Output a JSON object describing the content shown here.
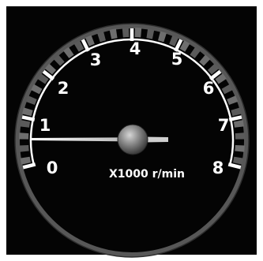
{
  "gauge": {
    "type": "tachometer",
    "unit_label": "X1000 r/min",
    "scale_labels": [
      "0",
      "1",
      "2",
      "3",
      "4",
      "5",
      "6",
      "7",
      "8"
    ],
    "min": 0,
    "max": 8,
    "needle_value": 0.9,
    "colors": {
      "background": "#040404",
      "scale_ring": "#ffffff",
      "segments": "#6e6e6e",
      "outer_ring": "#575757",
      "labels": "#ffffff",
      "hub": "#8a8a8a",
      "needle": "#bfbfbf"
    }
  }
}
